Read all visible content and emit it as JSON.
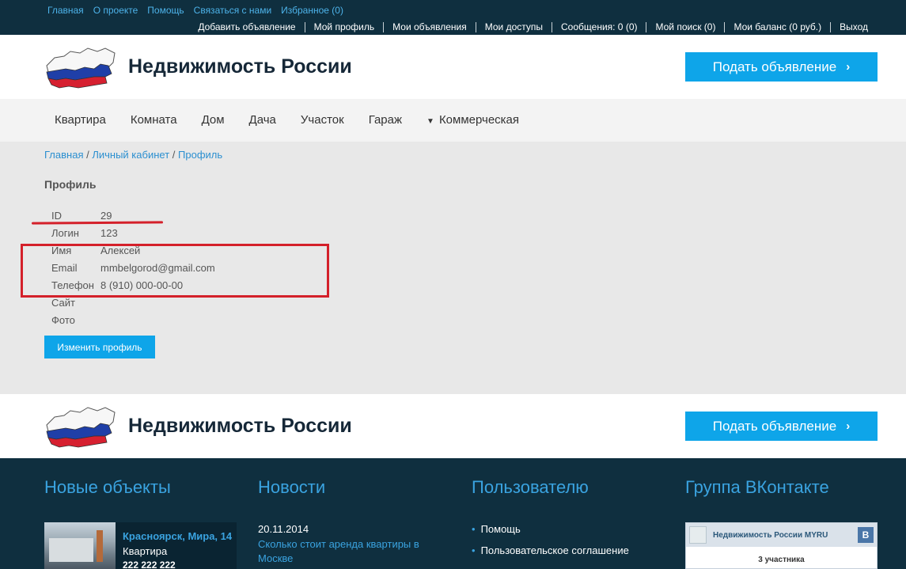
{
  "top_links": [
    "Главная",
    "О проекте",
    "Помощь",
    "Связаться с нами",
    "Избранное (0)"
  ],
  "user_menu": [
    "Добавить объявление",
    "Мой профиль",
    "Мои объявления",
    "Мои доступы",
    "Сообщения: 0 (0)",
    "Мой поиск (0)",
    "Мои баланс (0 руб.)",
    "Выход"
  ],
  "site_title": "Недвижимость России",
  "submit_label": "Подать объявление",
  "nav": [
    "Квартира",
    "Комната",
    "Дом",
    "Дача",
    "Участок",
    "Гараж",
    "Коммерческая"
  ],
  "breadcrumb": [
    "Главная",
    "Личный кабинет",
    "Профиль"
  ],
  "page_title": "Профиль",
  "profile": [
    {
      "label": "ID",
      "value": "29"
    },
    {
      "label": "Логин",
      "value": "123"
    },
    {
      "label": "Имя",
      "value": "Алексей"
    },
    {
      "label": "Email",
      "value": "mmbelgorod@gmail.com"
    },
    {
      "label": "Телефон",
      "value": "8 (910) 000-00-00"
    },
    {
      "label": "Сайт",
      "value": ""
    },
    {
      "label": "Фото",
      "value": ""
    }
  ],
  "edit_profile_label": "Изменить профиль",
  "footer": {
    "new_objects_title": "Новые объекты",
    "news_title": "Новости",
    "user_title": "Пользователю",
    "vk_title": "Группа ВКонтакте",
    "new_object": {
      "address": "Красноярск, Мира, 14",
      "type": "Квартира",
      "phone": "222 222 222"
    },
    "news_item": {
      "date": "20.11.2014",
      "title": "Сколько стоит аренда квартиры в Москве"
    },
    "user_links": [
      "Помощь",
      "Пользовательское соглашение"
    ],
    "vk": {
      "group_name": "Недвижимость России MYRU",
      "logo": "В",
      "members": "3 участника"
    }
  },
  "colors": {
    "accent": "#0ea5e9",
    "dark": "#0f2f3f",
    "link": "#2b8fd0",
    "annotation": "#d4202a"
  }
}
